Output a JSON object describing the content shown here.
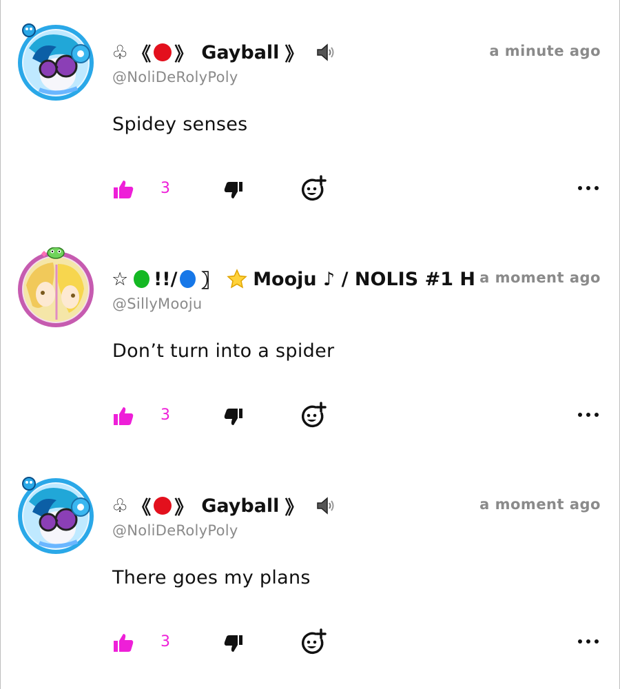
{
  "comments": [
    {
      "avatar_icon": "vinyl-scratch-avatar-icon",
      "name": {
        "club": "♧",
        "open": "《",
        "dot_color": "#e3101d",
        "close": "》",
        "text": "Gayball",
        "end": "》",
        "speaker": "🔈"
      },
      "handle": "@NoliDeRolyPoly",
      "timestamp": "a minute ago",
      "body": "Spidey senses",
      "likes": "3"
    },
    {
      "avatar_icon": "precure-avatar-icon",
      "name": {
        "star": "☆",
        "dot1_color": "#14b823",
        "sep": "!!/",
        "dot2_color": "#1677e8",
        "bracket": "〗",
        "star2": "⭐",
        "text": "Mooju ♪ / NOLIS #1 H"
      },
      "handle": "@SillyMooju",
      "timestamp": "a moment ago",
      "body": "Don’t turn into a spider",
      "likes": "3"
    },
    {
      "avatar_icon": "vinyl-scratch-avatar-icon",
      "name": {
        "club": "♧",
        "open": "《",
        "dot_color": "#e3101d",
        "close": "》",
        "text": "Gayball",
        "end": "》",
        "speaker": "🔈"
      },
      "handle": "@NoliDeRolyPoly",
      "timestamp": "a moment ago",
      "body": "There goes my plans",
      "likes": "3"
    }
  ],
  "colors": {
    "accent": "#ee1fd8",
    "muted": "#8a8a8a",
    "text": "#111111"
  },
  "icons": {
    "like": "thumbs-up-icon",
    "dislike": "thumbs-down-icon",
    "react": "add-emoji-icon",
    "more": "more-options-icon"
  }
}
